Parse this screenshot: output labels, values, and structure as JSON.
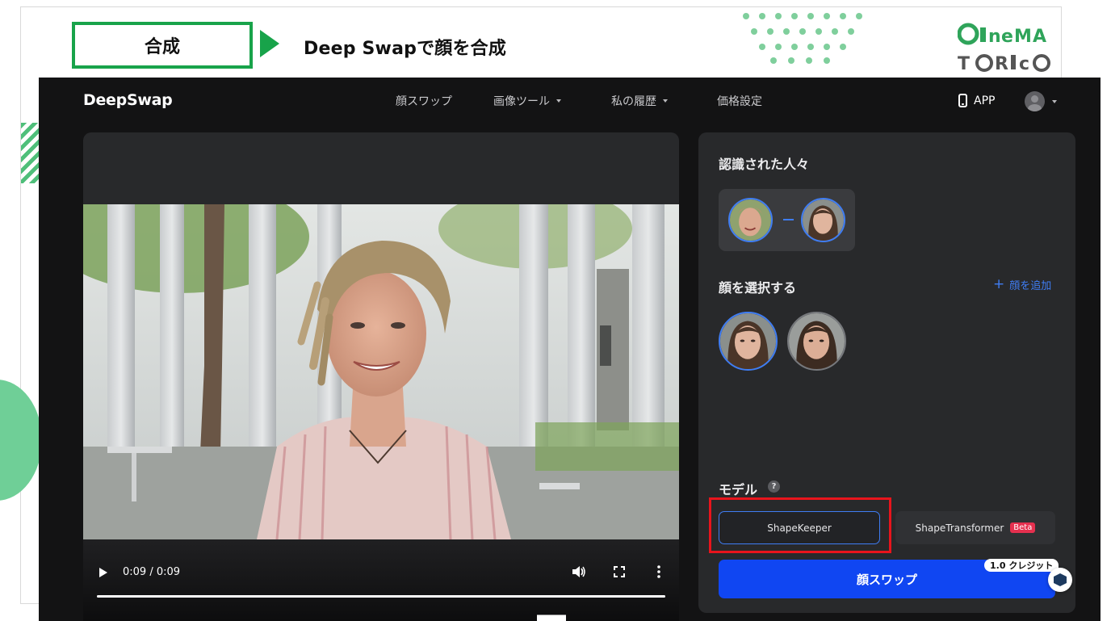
{
  "article": {
    "step_label": "合成",
    "step_caption": "Deep Swapで顔を合成",
    "brand_logo_text": "CINEMA TORICO",
    "accent_color": "#18a34a"
  },
  "app": {
    "logo": "DeepSwap",
    "nav": {
      "face_swap": "顔スワップ",
      "image_tools": "画像ツール",
      "history": "私の履歴",
      "pricing": "価格設定",
      "app_label": "APP"
    },
    "video": {
      "time": "0:09 / 0:09",
      "progress": 1.0
    },
    "panel": {
      "recognized_title": "認識された人々",
      "select_face_title": "顔を選択する",
      "add_face_label": "顔を追加",
      "model_title": "モデル",
      "help_glyph": "?",
      "models": {
        "keeper": "ShapeKeeper",
        "transformer": "ShapeTransformer",
        "beta": "Beta"
      },
      "swap_button": "顔スワップ",
      "credit_badge": "1.0 クレジット"
    },
    "colors": {
      "accent_blue": "#1046f2",
      "highlight_red": "#e8141c"
    }
  }
}
